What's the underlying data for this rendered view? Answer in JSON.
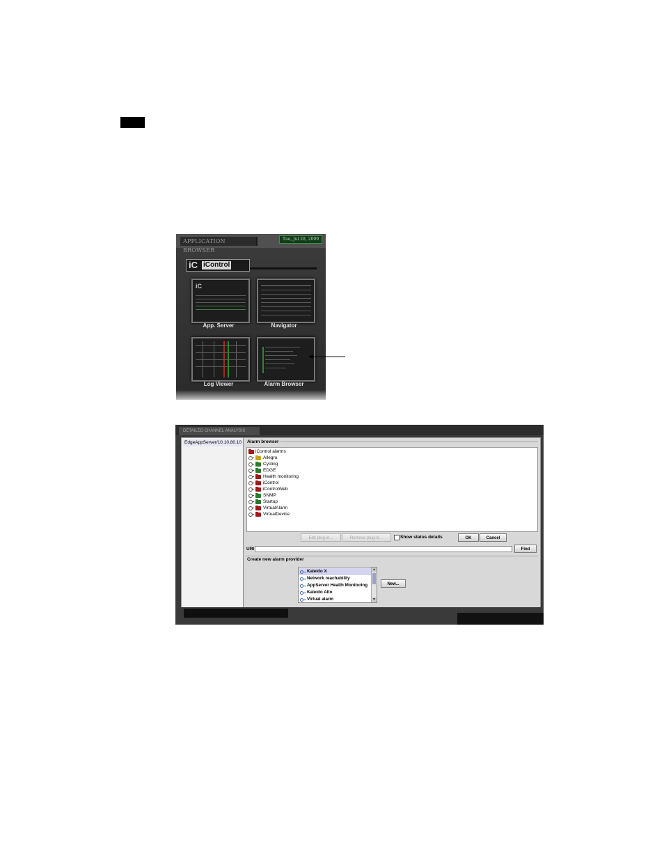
{
  "app_browser": {
    "title": "APPLICATION BROWSER",
    "date": "Tue, Jul 28, 2009",
    "logo_ic": "iC",
    "logo_text": "iControl",
    "apps": [
      {
        "label": "App. Server"
      },
      {
        "label": "Navigator"
      },
      {
        "label": "Log Viewer"
      },
      {
        "label": "Alarm Browser"
      }
    ]
  },
  "dca": {
    "title": "DETAILED CHANNEL ANALYSIS",
    "server_item": "EdgeAppServer/10.10.80.10",
    "alarm_browser_label": "Alarm browser",
    "tree": {
      "root": "iControl alarms",
      "items": [
        {
          "label": "Allegro",
          "color": "#c9a21a"
        },
        {
          "label": "Cycling",
          "color": "#2b7a2b"
        },
        {
          "label": "EDGE",
          "color": "#2b7a2b"
        },
        {
          "label": "Health monitoring",
          "color": "#a01818"
        },
        {
          "label": "iControl",
          "color": "#a01818"
        },
        {
          "label": "iControlWeb",
          "color": "#a01818"
        },
        {
          "label": "SNMP",
          "color": "#2b7a2b"
        },
        {
          "label": "Startup",
          "color": "#2b7a2b"
        },
        {
          "label": "VirtualAlarm",
          "color": "#a01818"
        },
        {
          "label": "VirtualDevice",
          "color": "#a01818"
        }
      ]
    },
    "buttons": {
      "edit_plugin": "Edit plug-in...",
      "remove_plugin": "Remove plug-in...",
      "show_status": "Show status details",
      "ok": "OK",
      "cancel": "Cancel",
      "find": "Find",
      "new": "New..."
    },
    "uri_label": "URI",
    "uri_value": "",
    "create_label": "Create new alarm provider",
    "providers": [
      {
        "label": "Kaleido X",
        "selected": true
      },
      {
        "label": "Network reachability",
        "selected": false
      },
      {
        "label": "AppServer Health Monitoring",
        "selected": false
      },
      {
        "label": "Kaleido Alto",
        "selected": false
      },
      {
        "label": "Virtual alarm",
        "selected": false
      }
    ]
  },
  "colors": {
    "root_folder": "#a01818",
    "selection": "#d4d4f0"
  }
}
